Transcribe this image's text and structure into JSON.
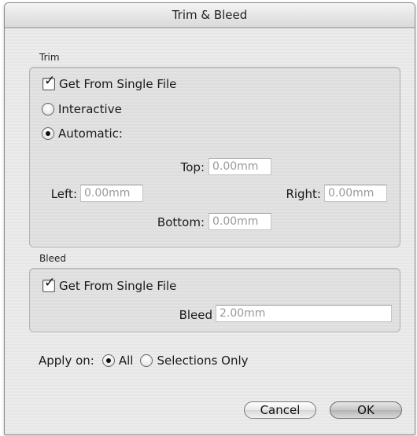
{
  "window": {
    "title": "Trim & Bleed"
  },
  "trim": {
    "group_label": "Trim",
    "get_from_single_file": {
      "label": "Get From Single File",
      "checked": true
    },
    "interactive": {
      "label": "Interactive",
      "selected": false
    },
    "automatic": {
      "label": "Automatic:",
      "selected": true
    },
    "top": {
      "label": "Top:",
      "value": "0.00mm"
    },
    "left": {
      "label": "Left:",
      "value": "0.00mm"
    },
    "right": {
      "label": "Right:",
      "value": "0.00mm"
    },
    "bottom": {
      "label": "Bottom:",
      "value": "0.00mm"
    }
  },
  "bleed": {
    "group_label": "Bleed",
    "get_from_single_file": {
      "label": "Get From Single File",
      "checked": true
    },
    "bleed_field": {
      "label": "Bleed",
      "value": "2.00mm"
    }
  },
  "apply_on": {
    "label": "Apply on:",
    "options": [
      {
        "label": "All",
        "selected": true
      },
      {
        "label": "Selections Only",
        "selected": false
      }
    ]
  },
  "buttons": {
    "cancel": "Cancel",
    "ok": "OK"
  },
  "icons": {
    "check": "✓"
  }
}
